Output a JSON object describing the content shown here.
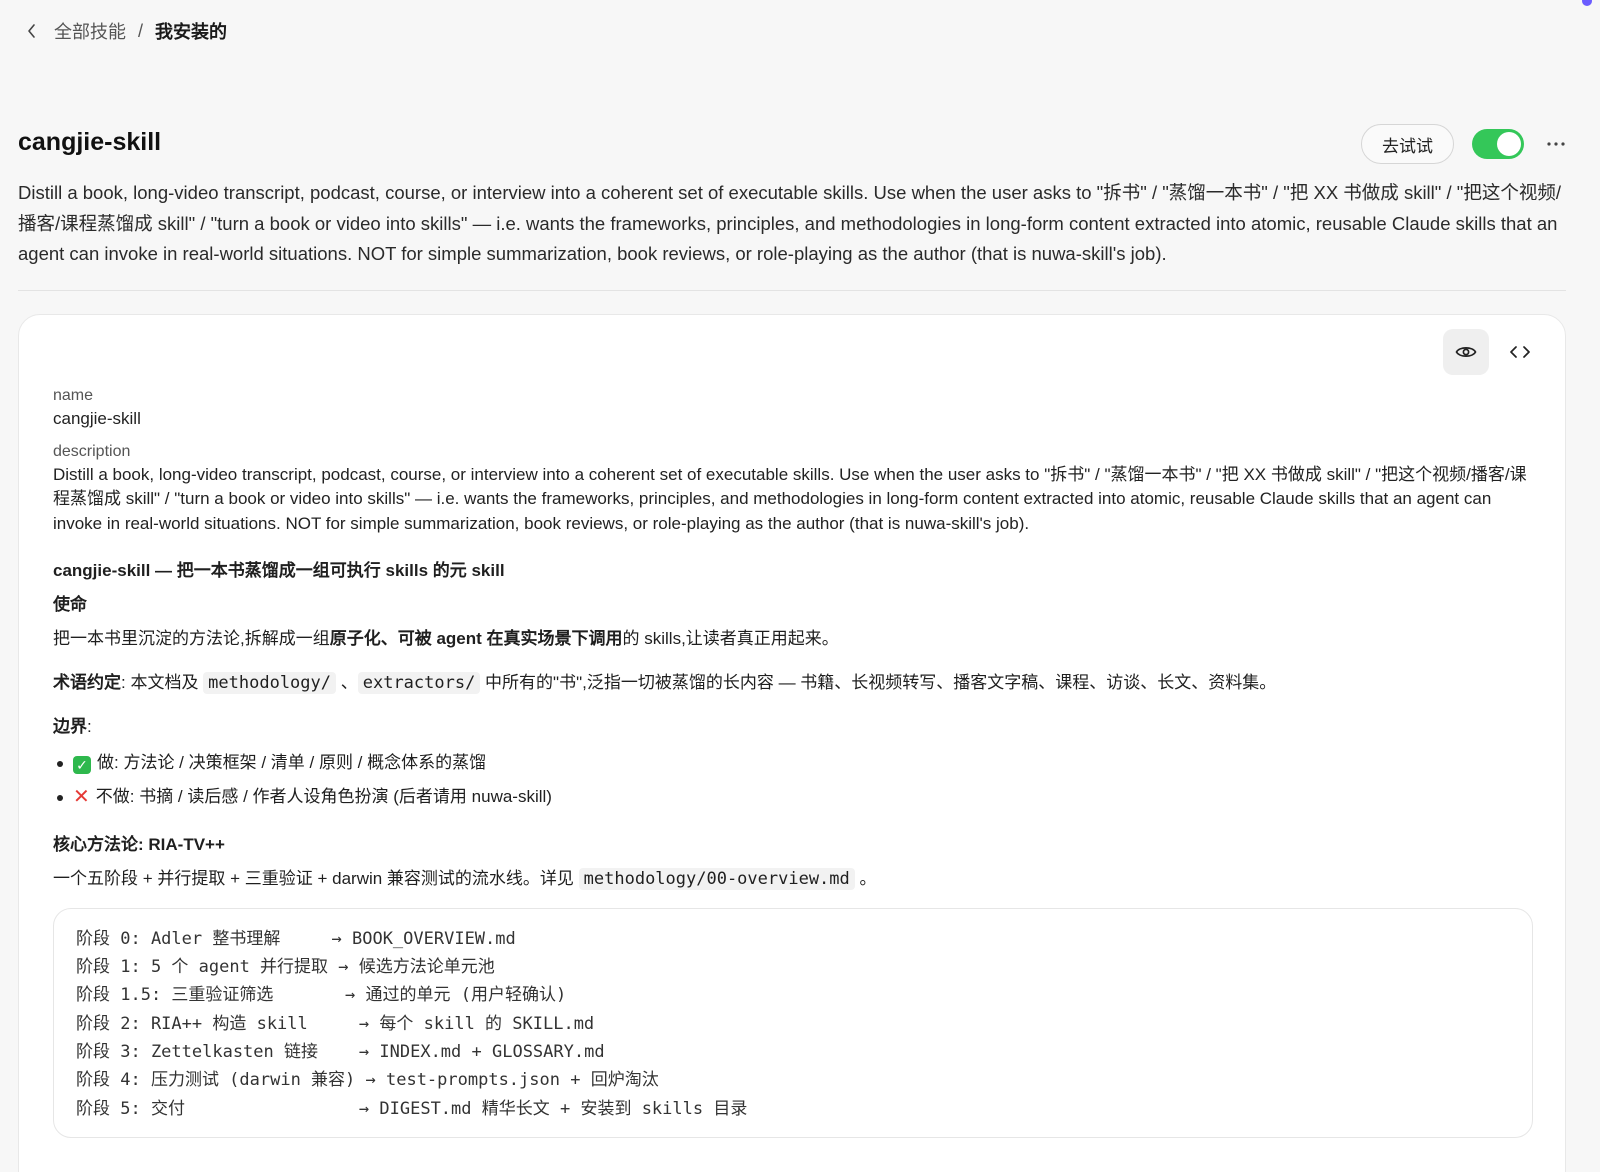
{
  "breadcrumb": {
    "parent": "全部技能",
    "separator": "/",
    "current": "我安装的"
  },
  "header": {
    "title": "cangjie-skill",
    "try_button": "去试试",
    "enabled": true,
    "description": "Distill a book, long-video transcript, podcast, course, or interview into a coherent set of executable skills. Use when the user asks to \"拆书\" / \"蒸馏一本书\" / \"把 XX 书做成 skill\" / \"把这个视频/播客/课程蒸馏成 skill\" / \"turn a book or video into skills\" — i.e. wants the frameworks, principles, and methodologies in long-form content extracted into atomic, reusable Claude skills that an agent can invoke in real-world situations. NOT for simple summarization, book reviews, or role-playing as the author (that is nuwa-skill's job)."
  },
  "frontmatter": {
    "name_label": "name",
    "name_value": "cangjie-skill",
    "description_label": "description",
    "description_value": "Distill a book, long-video transcript, podcast, course, or interview into a coherent set of executable skills. Use when the user asks to \"拆书\" / \"蒸馏一本书\" / \"把 XX 书做成 skill\" / \"把这个视频/播客/课程蒸馏成 skill\" / \"turn a book or video into skills\" — i.e. wants the frameworks, principles, and methodologies in long-form content extracted into atomic, reusable Claude skills that an agent can invoke in real-world situations. NOT for simple summarization, book reviews, or role-playing as the author (that is nuwa-skill's job)."
  },
  "markdown": {
    "h1": "cangjie-skill — 把一本书蒸馏成一组可执行 skills 的元 skill",
    "mission_heading": "使命",
    "mission_pre": "把一本书里沉淀的方法论,拆解成一组",
    "mission_bold": "原子化、可被 agent 在真实场景下调用",
    "mission_post": "的 skills,让读者真正用起来。",
    "terms_label": "术语约定",
    "terms_colon": ": 本文档及 ",
    "terms_code1": "methodology/",
    "terms_sep": " 、",
    "terms_code2": "extractors/",
    "terms_rest": " 中所有的\"书\",泛指一切被蒸馏的长内容 — 书籍、长视频转写、播客文字稿、课程、访谈、长文、资料集。",
    "boundary_label": "边界",
    "boundary_colon": ":",
    "boundary_do": "做: 方法论 / 决策框架 / 清单 / 原则 / 概念体系的蒸馏",
    "boundary_dont": "不做: 书摘 / 读后感 / 作者人设角色扮演 (后者请用 nuwa-skill)",
    "core_label": "核心方法论: RIA-TV++",
    "core_text": "一个五阶段 + 并行提取 + 三重验证 + darwin 兼容测试的流水线。详见 ",
    "core_code": "methodology/00-overview.md",
    "core_end": " 。",
    "code_lines": [
      "阶段 0: Adler 整书理解     → BOOK_OVERVIEW.md",
      "阶段 1: 5 个 agent 并行提取 → 候选方法论单元池",
      "阶段 1.5: 三重验证筛选       → 通过的单元 (用户轻确认)",
      "阶段 2: RIA++ 构造 skill     → 每个 skill 的 SKILL.md",
      "阶段 3: Zettelkasten 链接    → INDEX.md + GLOSSARY.md",
      "阶段 4: 压力测试 (darwin 兼容) → test-prompts.json + 回炉淘汰",
      "阶段 5: 交付                 → DIGEST.md 精华长文 + 安装到 skills 目录"
    ]
  },
  "icons": {
    "back": "chevron-left-icon",
    "more": "more-horizontal-icon",
    "preview": "eye-icon",
    "source": "code-icon"
  },
  "colors": {
    "toggle_on": "#34c759",
    "accent_dot": "#6b5cff"
  }
}
